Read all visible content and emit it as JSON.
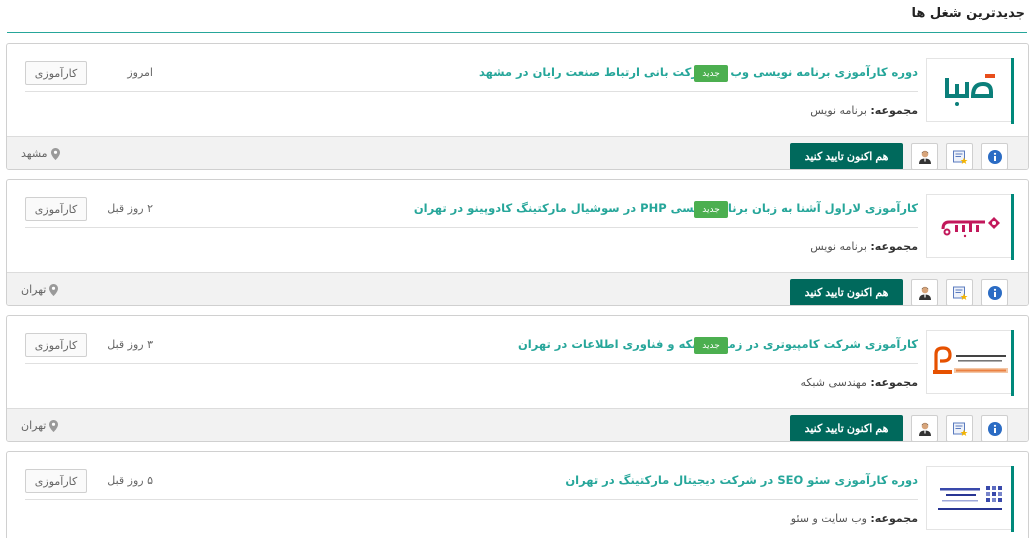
{
  "page": {
    "title": "جدیدترین شغل ها"
  },
  "labels": {
    "category_label": "مجموعه:",
    "apply_label": "هم اکنون تایید کنید",
    "new_badge": "جدید"
  },
  "colors": {
    "accent": "#26a69a",
    "button": "#00695c",
    "badge": "#4caf50"
  },
  "jobs": [
    {
      "title": "دوره کارآموزی برنامه نویسی وب در شرکت بانی ارتباط صنعت رایان در مشهد",
      "is_new": true,
      "date": "امروز",
      "type": "کارآموزی",
      "category": "برنامه نویس",
      "location": "مشهد",
      "logo_icon": "basamar-logo"
    },
    {
      "title": "کارآموزی لاراول آشنا به زبان برنامه نویسی PHP در سوشیال مارکتینگ کادوپینو در تهران",
      "is_new": true,
      "date": "۲ روز قبل",
      "type": "کارآموزی",
      "category": "برنامه نویس",
      "location": "تهران",
      "logo_icon": "kadoopino-logo"
    },
    {
      "title": "کارآموزی شرکت کامپیوتری در زمینه شبکه و فناوری اطلاعات در تهران",
      "is_new": true,
      "date": "۳ روز قبل",
      "type": "کارآموزی",
      "category": "مهندسی شبکه",
      "location": "تهران",
      "logo_icon": "rayan-pardaz-logo"
    },
    {
      "title": "دوره کارآموزی سئو SEO در شرکت دیجیتال مارکتینگ در تهران",
      "is_new": false,
      "date": "۵ روز قبل",
      "type": "کارآموزی",
      "category": "وب سایت و سئو",
      "location": "",
      "logo_icon": "digital-marketing-logo"
    }
  ]
}
